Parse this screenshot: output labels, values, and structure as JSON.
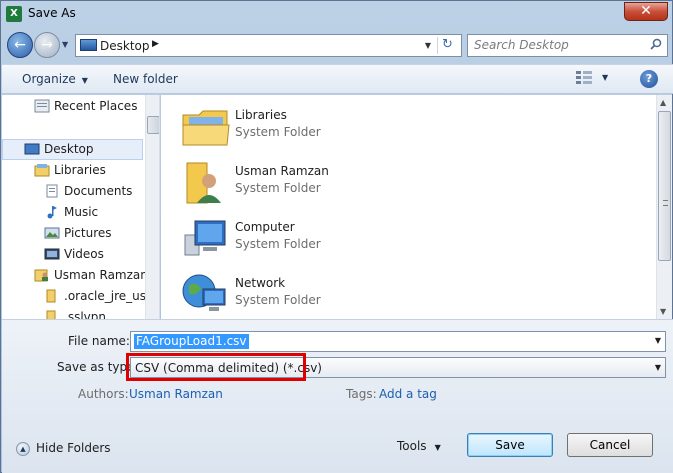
{
  "window": {
    "title": "Save As",
    "app_icon": "excel-icon",
    "close_glyph": "✕"
  },
  "address_bar": {
    "breadcrumb": [
      "Desktop"
    ],
    "separator": "▶"
  },
  "search": {
    "placeholder": "Search Desktop"
  },
  "toolbar": {
    "organize_label": "Organize",
    "new_folder_label": "New folder",
    "help_glyph": "?"
  },
  "navigation": {
    "items": [
      {
        "label": "Recent Places",
        "icon": "recent-places-icon"
      },
      {
        "label": "Desktop",
        "icon": "desktop-icon",
        "selected": true
      },
      {
        "label": "Libraries",
        "icon": "libraries-icon"
      },
      {
        "label": "Documents",
        "icon": "documents-icon"
      },
      {
        "label": "Music",
        "icon": "music-icon"
      },
      {
        "label": "Pictures",
        "icon": "pictures-icon"
      },
      {
        "label": "Videos",
        "icon": "videos-icon"
      },
      {
        "label": "Usman Ramzan",
        "icon": "user-folder-icon"
      },
      {
        "label": ".oracle_jre_usag",
        "icon": "folder-icon"
      },
      {
        "label": ".sslvpn",
        "icon": "folder-icon"
      }
    ]
  },
  "files": [
    {
      "name": "Libraries",
      "type": "System Folder",
      "icon": "libraries-icon"
    },
    {
      "name": "Usman Ramzan",
      "type": "System Folder",
      "icon": "user-folder-icon"
    },
    {
      "name": "Computer",
      "type": "System Folder",
      "icon": "computer-icon"
    },
    {
      "name": "Network",
      "type": "System Folder",
      "icon": "network-icon"
    }
  ],
  "form": {
    "file_name_label": "File name:",
    "file_name_value": "FAGroupLoad1.csv",
    "save_as_type_label": "Save as type:",
    "save_as_type_value": "CSV (Comma delimited) (*.csv)",
    "authors_label": "Authors:",
    "authors_value": "Usman Ramzan",
    "tags_label": "Tags:",
    "tags_value": "Add a tag"
  },
  "footer": {
    "hide_folders_label": "Hide Folders",
    "tools_label": "Tools",
    "save_label": "Save",
    "cancel_label": "Cancel"
  },
  "colors": {
    "highlight_border": "#e10000",
    "selection": "#3399ff",
    "link": "#1c5fb0"
  }
}
